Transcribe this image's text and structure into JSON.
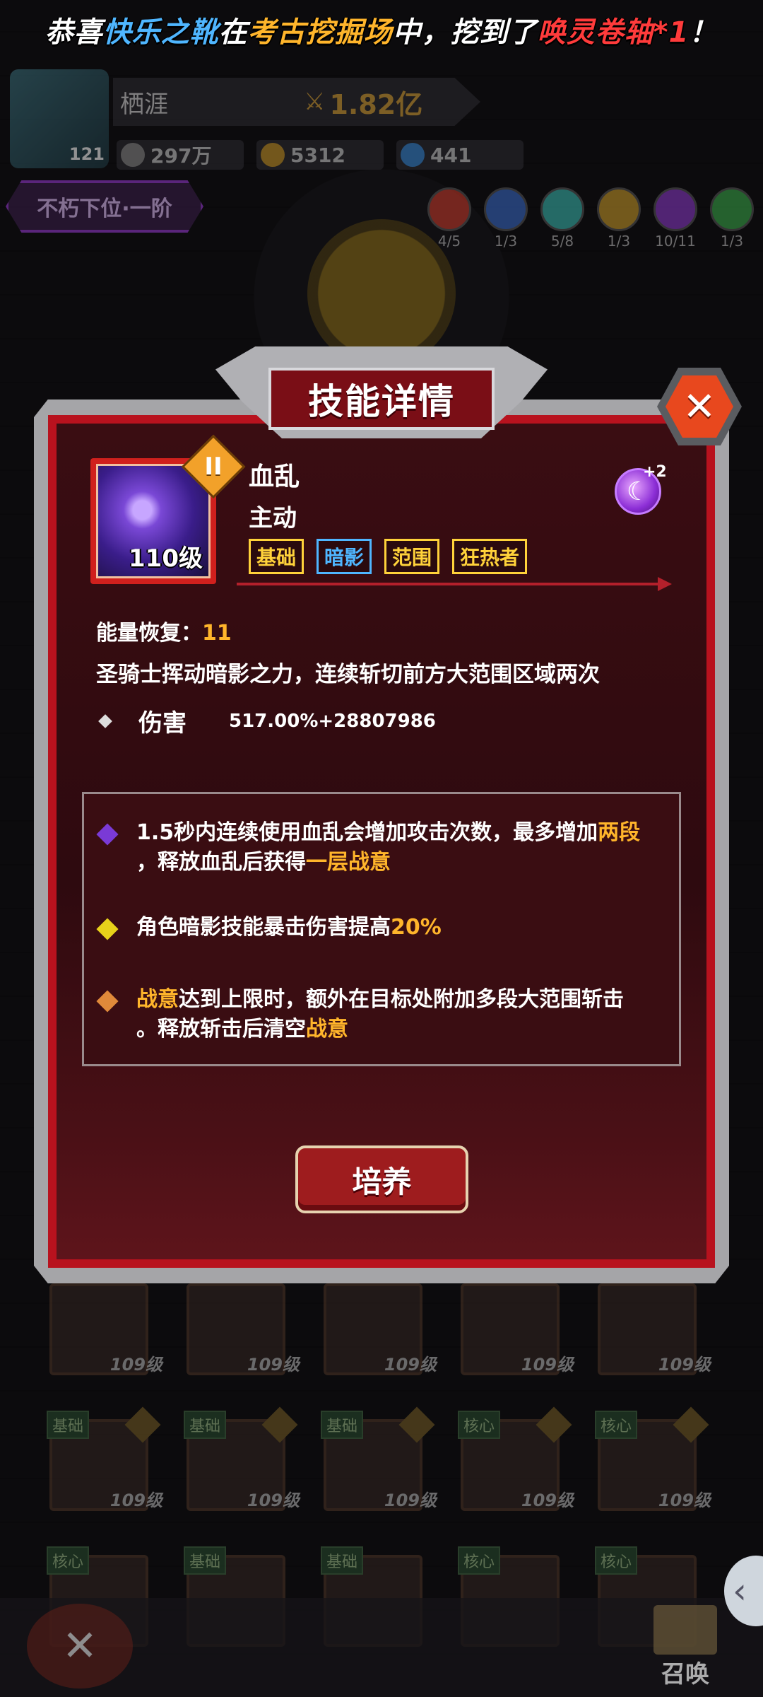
{
  "notice": {
    "part1": "恭喜",
    "player": "快乐之靴",
    "part2": "在",
    "location": "考古挖掘场",
    "part3": "中，挖到了",
    "item": "唤灵卷轴*1",
    "part4": "！"
  },
  "profile": {
    "player_name": "栖涯",
    "level": "121",
    "power": "1.82亿",
    "currencies": [
      "297万",
      "5312",
      "441"
    ],
    "rank": "不朽下位·一阶",
    "elements": [
      {
        "count": "4/5",
        "color": "#c83a2a"
      },
      {
        "count": "1/3",
        "color": "#3a6bc8"
      },
      {
        "count": "5/8",
        "color": "#3ab8b0"
      },
      {
        "count": "1/3",
        "color": "#c89a2a"
      },
      {
        "count": "10/11",
        "color": "#8a3ac8"
      },
      {
        "count": "1/3",
        "color": "#3aa84a"
      }
    ]
  },
  "modal": {
    "title": "技能详情",
    "close_symbol": "✕",
    "skill": {
      "tier": "II",
      "level": "110级",
      "name": "血乱",
      "type": "主动",
      "tags": [
        {
          "label": "基础",
          "color": "#ffd23a"
        },
        {
          "label": "暗影",
          "color": "#4fb6ff"
        },
        {
          "label": "范围",
          "color": "#ffd23a"
        },
        {
          "label": "狂热者",
          "color": "#ffd23a"
        }
      ],
      "rune_plus": "+2",
      "energy_label": "能量恢复：",
      "energy_value": "11",
      "description": "圣骑士挥动暗影之力，连续斩切前方大范围区域两次",
      "damage_label": "伤害",
      "damage_value": "517.00%+28807986"
    },
    "effects": [
      {
        "gem_color": "#7a3ad6",
        "line1_a": "1.5秒内连续使用血乱会增加攻击次数，最多增加",
        "line1_hl": "两段",
        "line2_a": "，释放血乱后获得",
        "line2_hl": "一层战意"
      },
      {
        "gem_color": "#e8d21a",
        "line1_a": "角色暗影技能暴击伤害提高",
        "line1_hl": "20%"
      },
      {
        "gem_color": "#e08a3a",
        "line1_hl": "战意",
        "line1_a": "达到上限时，额外在目标处附加多段大范围斩击",
        "line2_a": "。释放斩击后清空",
        "line2_hl": "战意"
      }
    ],
    "train_button": "培养"
  },
  "skill_grid": {
    "rows": [
      [
        {
          "tag": "",
          "level": "109级"
        },
        {
          "tag": "",
          "level": "109级"
        },
        {
          "tag": "",
          "level": "109级"
        },
        {
          "tag": "",
          "level": "109级"
        },
        {
          "tag": "",
          "level": "109级"
        }
      ],
      [
        {
          "tag": "基础",
          "level": "109级"
        },
        {
          "tag": "基础",
          "level": "109级"
        },
        {
          "tag": "基础",
          "level": "109级"
        },
        {
          "tag": "核心",
          "level": "109级"
        },
        {
          "tag": "核心",
          "level": "109级"
        }
      ],
      [
        {
          "tag": "核心",
          "level": ""
        },
        {
          "tag": "基础",
          "level": ""
        },
        {
          "tag": "基础",
          "level": ""
        },
        {
          "tag": "核心",
          "level": ""
        },
        {
          "tag": "核心",
          "level": ""
        }
      ]
    ]
  },
  "bottom": {
    "summon_label": "召唤",
    "close_symbol": "✕",
    "side_arrow": "‹"
  }
}
